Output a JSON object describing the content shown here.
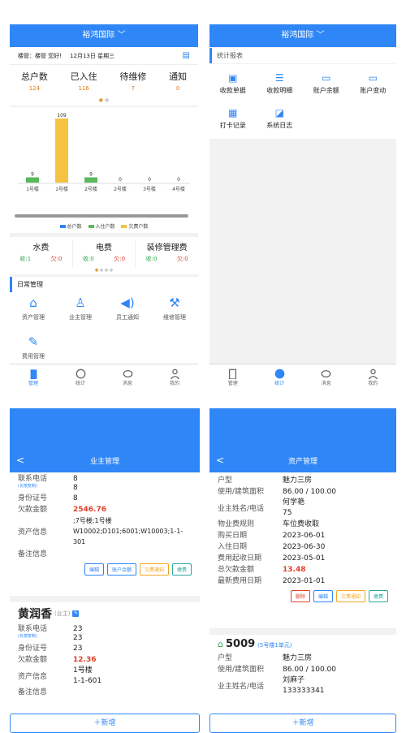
{
  "screen1": {
    "title": "裕鸿国际",
    "greeting": "楼管：楼管 您好!",
    "date": "12月13日 星期三",
    "stats": [
      {
        "label": "总户数",
        "value": "124"
      },
      {
        "label": "已入住",
        "value": "116"
      },
      {
        "label": "待维修",
        "value": "7"
      },
      {
        "label": "通知",
        "value": "0"
      }
    ],
    "legend": [
      "总户数",
      "入住户数",
      "欠费户数"
    ],
    "fees": [
      {
        "name": "水费",
        "recv": "收:1",
        "owe": "欠:0"
      },
      {
        "name": "电费",
        "recv": "收:0",
        "owe": "欠:0"
      },
      {
        "name": "装修管理费",
        "recv": "收:0",
        "owe": "欠:0"
      }
    ],
    "section": "日常管理",
    "menu": [
      "资产管理",
      "业主管理",
      "员工通知",
      "维修管理",
      "费用管理"
    ],
    "tabs": [
      "管理",
      "统计",
      "消息",
      "我的"
    ]
  },
  "chart_data": {
    "type": "bar",
    "categories": [
      "1号楼",
      "1号楼",
      "2号楼",
      "2号楼",
      "3号楼",
      "4号楼"
    ],
    "series": [
      {
        "name": "总户数",
        "values": [
          9,
          109,
          9,
          0,
          0,
          0
        ],
        "color": "#2f86f6"
      },
      {
        "name": "入住户数",
        "values": [
          9,
          109,
          9,
          0,
          0,
          0
        ],
        "color": "#5cb85c"
      },
      {
        "name": "欠费户数",
        "values": [
          0,
          109,
          0,
          0,
          0,
          0
        ],
        "color": "#f5c244"
      }
    ],
    "bars": [
      {
        "value": 9,
        "color": "#5cb85c",
        "label": "9"
      },
      {
        "value": 109,
        "color": "#f5c244",
        "label": "109"
      },
      {
        "value": 9,
        "color": "#5cb85c",
        "label": "9"
      },
      {
        "value": 0,
        "color": "#5cb85c",
        "label": "0"
      },
      {
        "value": 0,
        "color": "#5cb85c",
        "label": "0"
      },
      {
        "value": 0,
        "color": "#5cb85c",
        "label": "0"
      }
    ],
    "ylim": [
      0,
      109
    ]
  },
  "screen2": {
    "title": "裕鸿国际",
    "section": "统计报表",
    "items": [
      "收款单据",
      "收款明细",
      "账户余额",
      "账户变动",
      "打卡记录",
      "系统日志"
    ],
    "tabs": [
      "管理",
      "统计",
      "消息",
      "我的"
    ]
  },
  "screen3": {
    "title": "业主管理",
    "back": "<",
    "card1": {
      "phone_label": "联系电话",
      "copy": "(长按复制)",
      "phone": "8",
      "phone2": "8",
      "id_label": "身份证号",
      "id": "8",
      "owe_label": "欠款金额",
      "owe": "2546.76",
      "asset_label": "资产信息",
      "asset": "W10002;D101;6001;W10003;1-1-301",
      "asset_extra": ";7号楼;1号楼",
      "note_label": "备注信息"
    },
    "buttons": [
      "编辑",
      "账户余额",
      "欠费通知",
      "缴费"
    ],
    "card2": {
      "name": "黄润香",
      "tag": "(业主)",
      "phone_label": "联系电话",
      "copy": "(长按复制)",
      "phone": "23",
      "phone2": "23",
      "id_label": "身份证号",
      "id": "23",
      "owe_label": "欠款金额",
      "owe": "12.36",
      "asset_label": "资产信息",
      "asset1": "1号楼",
      "asset2": "1-1-601",
      "note_label": "备注信息"
    },
    "add": "＋新增"
  },
  "screen4": {
    "title": "资产管理",
    "back": "<",
    "card1": {
      "rows": [
        {
          "k": "户型",
          "v": "魅力三房"
        },
        {
          "k": "使用/建筑面积",
          "v": "86.00 / 100.00"
        }
      ],
      "owner_label": "业主姓名/电话",
      "owner": "何学艳",
      "owner_phone": "75",
      "rows2": [
        {
          "k": "物业费规则",
          "v": "车位费收取"
        },
        {
          "k": "购买日期",
          "v": "2023-06-01"
        },
        {
          "k": "入住日期",
          "v": "2023-06-30"
        },
        {
          "k": "费用起收日期",
          "v": "2023-05-01"
        }
      ],
      "owe_label": "总欠款金额",
      "owe": "13.48",
      "last_label": "最新费用日期",
      "last": "2023-01-01"
    },
    "buttons": [
      "删除",
      "编辑",
      "欠费通知",
      "缴费"
    ],
    "card2": {
      "unit": "5009",
      "unit_sub": "(5号楼1单元)",
      "rows": [
        {
          "k": "户型",
          "v": "魅力三房"
        },
        {
          "k": "使用/建筑面积",
          "v": "86.00 / 100.00"
        }
      ],
      "owner_label": "业主姓名/电话",
      "owner": "刘麻子",
      "owner_phone": "133333341"
    },
    "add": "＋新增"
  }
}
